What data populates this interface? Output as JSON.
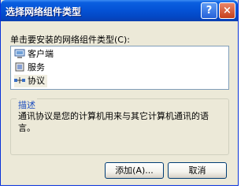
{
  "window": {
    "title": "选择网络组件类型",
    "help_icon": "?",
    "close_icon": "×"
  },
  "prompt": "单击要安装的网络组件类型(C):",
  "components": [
    {
      "label": "客户端",
      "icon": "client-icon"
    },
    {
      "label": "服务",
      "icon": "service-icon"
    },
    {
      "label": "协议",
      "icon": "protocol-icon"
    }
  ],
  "description": {
    "label": "描述",
    "text": "通讯协议是您的计算机用来与其它计算机通讯的语言。"
  },
  "buttons": {
    "add": "添加(A)...",
    "cancel": "取消"
  },
  "colors": {
    "titlebar": "#0453d6",
    "dialog": "#ece9d8",
    "group_label": "#1f4fbf",
    "selected_row": "#f1efe2"
  }
}
